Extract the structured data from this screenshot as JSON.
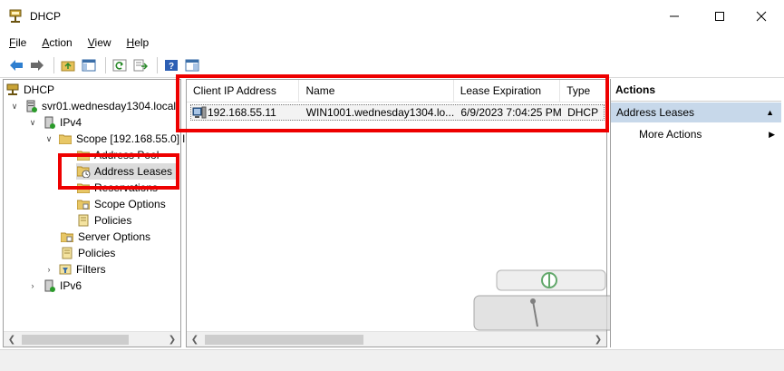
{
  "window": {
    "title": "DHCP"
  },
  "menu": [
    {
      "key": "F",
      "rest": "ile"
    },
    {
      "key": "A",
      "rest": "ction"
    },
    {
      "key": "V",
      "rest": "iew"
    },
    {
      "key": "H",
      "rest": "elp"
    }
  ],
  "tree": {
    "root": "DHCP",
    "server": "svr01.wednesday1304.local",
    "ipv4": "IPv4",
    "scope": "Scope [192.168.55.0] l",
    "address_pool": "Address Pool",
    "address_leases": "Address Leases",
    "reservations": "Reservations",
    "scope_options": "Scope Options",
    "scope_policies": "Policies",
    "server_options": "Server Options",
    "policies": "Policies",
    "filters": "Filters",
    "ipv6": "IPv6"
  },
  "list": {
    "columns": [
      "Client IP Address",
      "Name",
      "Lease Expiration",
      "Type"
    ],
    "rows": [
      {
        "ip": "192.168.55.11",
        "name": "WIN1001.wednesday1304.lo...",
        "expiration": "6/9/2023 7:04:25 PM",
        "type": "DHCP"
      }
    ]
  },
  "actions": {
    "header": "Actions",
    "section": "Address Leases",
    "more": "More Actions"
  },
  "colors": {
    "highlight": "#ee0000",
    "selection": "#c7d8ea"
  }
}
